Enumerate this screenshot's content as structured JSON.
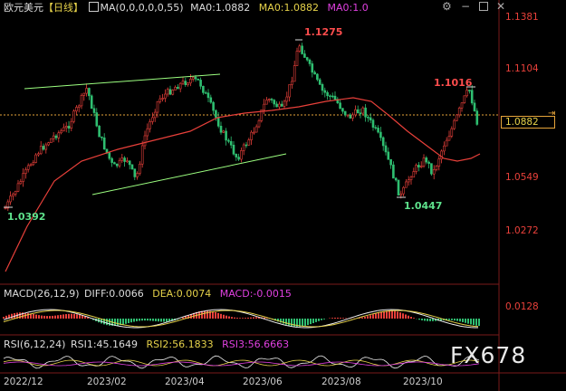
{
  "symbol": "欧元美元",
  "period": "【日线】",
  "main_indicator": {
    "label": "MA(0,0,0,0,0,55)",
    "items": [
      {
        "text": "MA0:1.0882",
        "color": "#e6d24a"
      },
      {
        "text": "MA0:1.0882",
        "color": "#e6d24a"
      },
      {
        "text": "MA0:1.0",
        "color": "#e040e0"
      }
    ]
  },
  "price_axis": {
    "labels": [
      "1.1381",
      "1.1104",
      "1.0549",
      "1.0272"
    ],
    "current": "1.0882"
  },
  "annotations": {
    "high": "1.1275",
    "mid_high": "1.1016",
    "low1": "1.0392",
    "low2": "1.0447"
  },
  "macd": {
    "label": "MACD(26,12,9)",
    "diff": "DIFF:0.0066",
    "dea": "DEA:0.0074",
    "macd": "MACD:-0.0015",
    "axis": "0.0128"
  },
  "rsi": {
    "label": "RSI(6,12,24)",
    "rsi1": "RSI1:45.1649",
    "rsi2": "RSI2:56.1833",
    "rsi3": "RSI3:56.6663"
  },
  "x_axis": [
    "2022/12",
    "2023/02",
    "2023/04",
    "2023/06",
    "2023/08",
    "2023/10"
  ],
  "watermark": "FX678",
  "colors": {
    "up": "#e8403a",
    "down": "#2fbf71",
    "ma": "#e8403a",
    "trend": "#9cff80",
    "price": "#e6d24a",
    "dea": "#e6d24a",
    "rsi2": "#e6d24a",
    "rsi3": "#e040e0"
  },
  "toolbar_icons": [
    "gear-icon",
    "minimize-icon",
    "restore-icon",
    "close-icon"
  ]
}
